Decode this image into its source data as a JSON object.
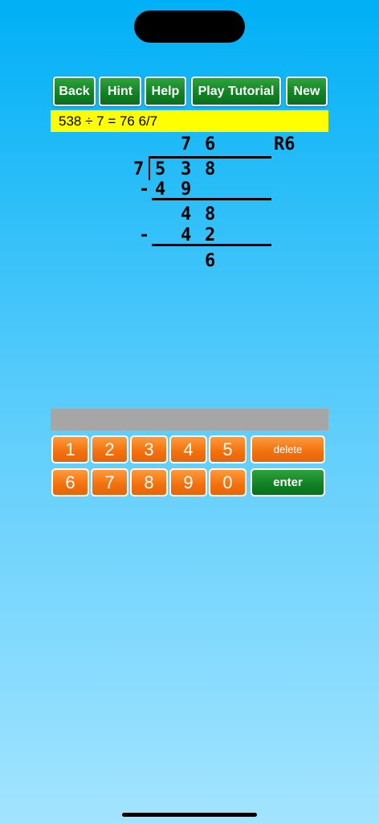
{
  "toolbar": {
    "back": "Back",
    "hint": "Hint",
    "help": "Help",
    "tutorial": "Play Tutorial",
    "new": "New"
  },
  "equation": "538 ÷ 7 = 76 6/7",
  "division": {
    "quotient": [
      "7",
      "6"
    ],
    "remainder": "R6",
    "divisor": "7",
    "dividend": [
      "5",
      "3",
      "8"
    ],
    "step1": {
      "minus": "-",
      "digits": [
        "4",
        "9"
      ]
    },
    "bringdown": [
      "4",
      "8"
    ],
    "step2": {
      "minus": "-",
      "digits": [
        "4",
        "2"
      ]
    },
    "final": "6"
  },
  "keypad": {
    "row1": [
      "1",
      "2",
      "3",
      "4",
      "5"
    ],
    "row2": [
      "6",
      "7",
      "8",
      "9",
      "0"
    ],
    "delete": "delete",
    "enter": "enter"
  }
}
